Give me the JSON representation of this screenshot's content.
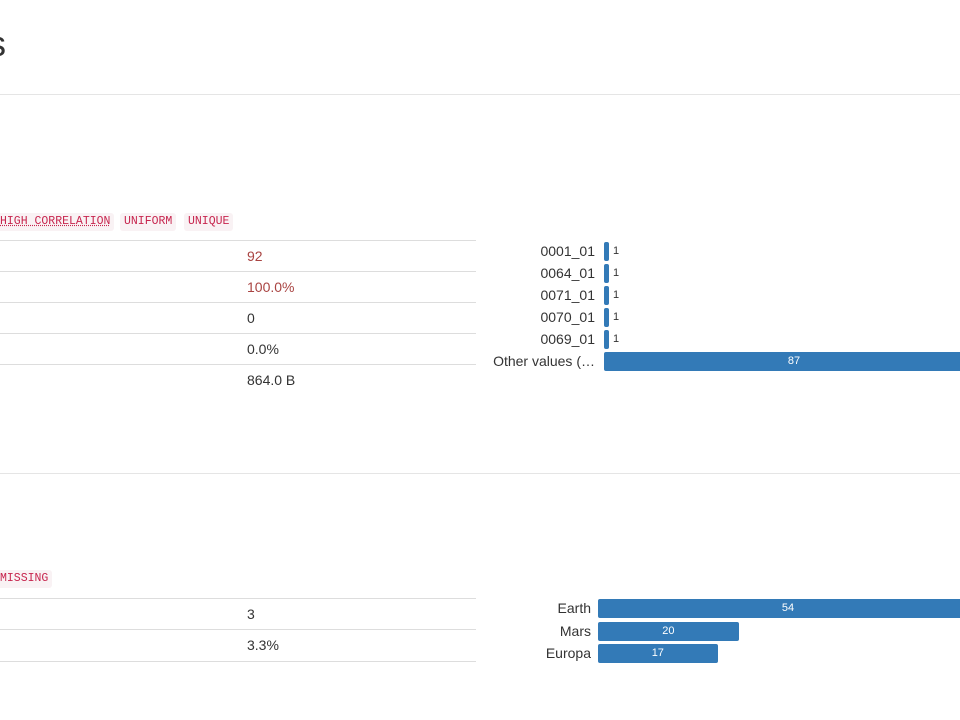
{
  "page": {
    "title_fragment": "s"
  },
  "variable1": {
    "badges": [
      "HIGH CORRELATION",
      "UNIFORM",
      "UNIQUE"
    ],
    "stats": [
      "92",
      "100.0%",
      "0",
      "0.0%",
      "864.0 B"
    ],
    "chart_data": {
      "type": "bar",
      "orientation": "horizontal",
      "categories": [
        "0001_01",
        "0064_01",
        "0071_01",
        "0070_01",
        "0069_01",
        "Other values (…"
      ],
      "values": [
        1,
        1,
        1,
        1,
        1,
        87
      ],
      "value_labels": [
        "1",
        "1",
        "1",
        "1",
        "1",
        "87"
      ]
    }
  },
  "variable2": {
    "badges": [
      "MISSING"
    ],
    "stats": [
      "3",
      "3.3%"
    ],
    "chart_data": {
      "type": "bar",
      "orientation": "horizontal",
      "categories": [
        "Earth",
        "Mars",
        "Europa"
      ],
      "values": [
        54,
        20,
        17
      ],
      "value_labels": [
        "54",
        "20",
        "17"
      ]
    }
  },
  "colors": {
    "bar": "#337ab7",
    "alert_text": "#a94442",
    "badge_text": "#c7254e",
    "badge_bg": "#f9f2f4"
  }
}
